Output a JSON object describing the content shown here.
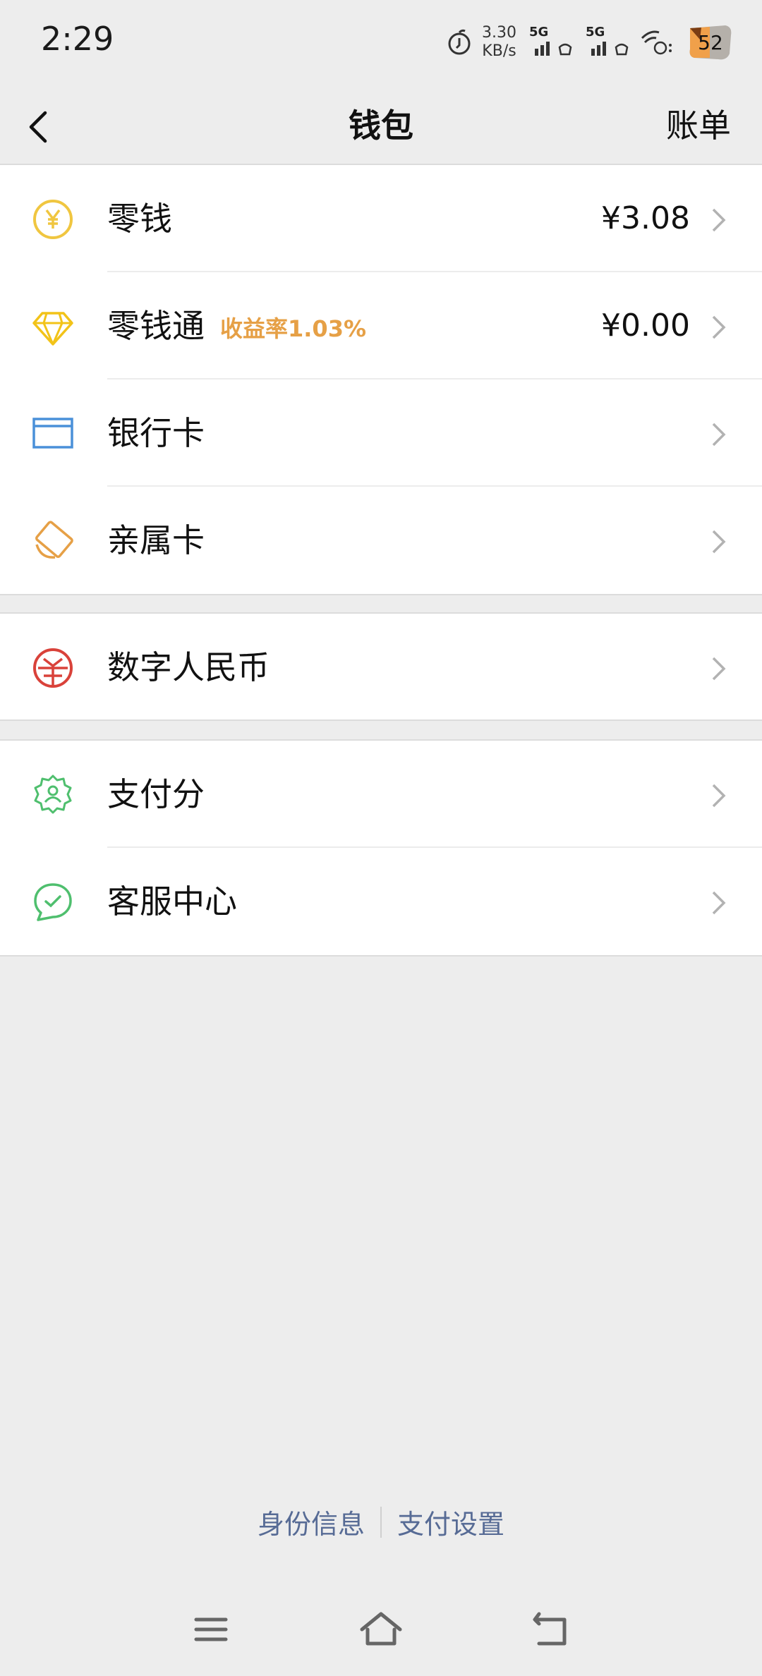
{
  "status_bar": {
    "time": "2:29",
    "net_speed_value": "3.30",
    "net_speed_unit": "KB/s",
    "sim1_label": "5G",
    "sim2_label": "5G",
    "battery_level": "52"
  },
  "nav": {
    "title": "钱包",
    "right_action": "账单"
  },
  "groups": [
    {
      "items": [
        {
          "label": "零钱",
          "value": "¥3.08",
          "icon": "yuan-coin-icon",
          "color": "#f0c640"
        },
        {
          "label": "零钱通",
          "sub": "收益率1.03%",
          "value": "¥0.00",
          "icon": "diamond-icon",
          "color": "#f2c318"
        },
        {
          "label": "银行卡",
          "icon": "bank-card-icon",
          "color": "#4a90d9"
        },
        {
          "label": "亲属卡",
          "icon": "family-card-icon",
          "color": "#e6a046"
        }
      ]
    },
    {
      "items": [
        {
          "label": "数字人民币",
          "icon": "digital-rmb-icon",
          "color": "#d9423a"
        }
      ]
    },
    {
      "items": [
        {
          "label": "支付分",
          "icon": "pay-score-icon",
          "color": "#4fbf6e"
        },
        {
          "label": "客服中心",
          "icon": "customer-service-icon",
          "color": "#4fbf6e"
        }
      ]
    }
  ],
  "footer": {
    "identity_link": "身份信息",
    "settings_link": "支付设置",
    "link_color": "#576b95"
  },
  "system_nav": {
    "menu": "menu-icon",
    "home": "home-icon",
    "back": "back-return-icon"
  }
}
